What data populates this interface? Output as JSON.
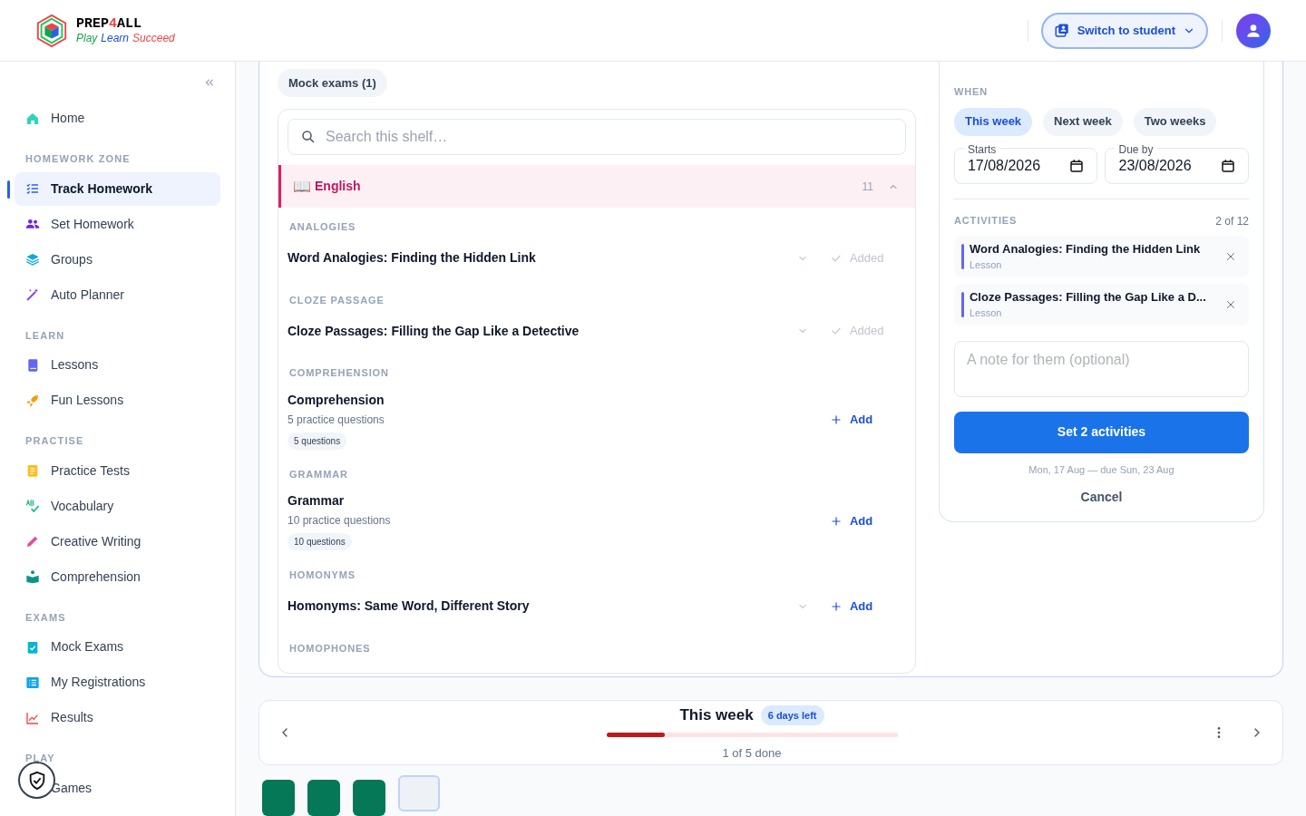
{
  "header": {
    "logo": {
      "name_parts": [
        "PREP",
        "4",
        "ALL"
      ],
      "tagline": [
        "Play",
        "Learn",
        "Succeed"
      ]
    },
    "switch_button": "Switch to student"
  },
  "sidebar": {
    "sections": [
      {
        "items": [
          {
            "label": "Home",
            "selected": false
          }
        ]
      },
      {
        "heading": "HOMEWORK ZONE",
        "items": [
          {
            "label": "Track Homework",
            "selected": true
          },
          {
            "label": "Set Homework",
            "selected": false
          },
          {
            "label": "Groups",
            "selected": false
          },
          {
            "label": "Auto Planner",
            "selected": false
          }
        ]
      },
      {
        "heading": "LEARN",
        "items": [
          {
            "label": "Lessons",
            "selected": false
          },
          {
            "label": "Fun Lessons",
            "selected": false
          }
        ]
      },
      {
        "heading": "PRACTISE",
        "items": [
          {
            "label": "Practice Tests",
            "selected": false
          },
          {
            "label": "Vocabulary",
            "selected": false
          },
          {
            "label": "Creative Writing",
            "selected": false
          },
          {
            "label": "Comprehension",
            "selected": false
          }
        ]
      },
      {
        "heading": "EXAMS",
        "items": [
          {
            "label": "Mock Exams",
            "selected": false
          },
          {
            "label": "My Registrations",
            "selected": false
          },
          {
            "label": "Results",
            "selected": false
          }
        ]
      },
      {
        "heading": "PLAY",
        "items": [
          {
            "label": "Games",
            "selected": false
          }
        ]
      }
    ]
  },
  "shelf": {
    "chip": "Mock exams (1)",
    "search": {
      "placeholder": "Search this shelf…"
    },
    "subject": {
      "emoji": "📖",
      "label": "English",
      "count": "11",
      "expanded": true
    },
    "groups": [
      {
        "heading": "ANALOGIES",
        "items": [
          {
            "title": "Word Analogies: Finding the Hidden Link",
            "expandable": true,
            "added": true,
            "action": "Added"
          }
        ]
      },
      {
        "heading": "CLOZE PASSAGE",
        "items": [
          {
            "title": "Cloze Passages: Filling the Gap Like a Detective",
            "expandable": true,
            "added": true,
            "action": "Added"
          }
        ]
      },
      {
        "heading": "COMPREHENSION",
        "items": [
          {
            "title": "Comprehension",
            "subtitle": "5 practice questions",
            "badge": "5 questions",
            "expandable": false,
            "added": false,
            "action": "Add"
          }
        ]
      },
      {
        "heading": "GRAMMAR",
        "items": [
          {
            "title": "Grammar",
            "subtitle": "10 practice questions",
            "badge": "10 questions",
            "expandable": false,
            "added": false,
            "action": "Add"
          }
        ]
      },
      {
        "heading": "HOMONYMS",
        "items": [
          {
            "title": "Homonyms: Same Word, Different Story",
            "expandable": true,
            "added": false,
            "action": "Add"
          }
        ]
      },
      {
        "heading": "HOMOPHONES"
      }
    ]
  },
  "set_homework": {
    "when_label": "WHEN",
    "periods": [
      {
        "label": "This week",
        "selected": true
      },
      {
        "label": "Next week",
        "selected": false
      },
      {
        "label": "Two weeks",
        "selected": false
      }
    ],
    "dates": [
      {
        "label": "Starts",
        "value": "17/08/2026"
      },
      {
        "label": "Due by",
        "value": "23/08/2026"
      }
    ],
    "activities_label": "ACTIVITIES",
    "activities_count": "2 of 12",
    "activities": [
      {
        "title": "Word Analogies: Finding the Hidden Link",
        "type": "Lesson"
      },
      {
        "title": "Cloze Passages: Filling the Gap Like a D...",
        "type": "Lesson"
      }
    ],
    "note": {
      "placeholder": "A note for them (optional)"
    },
    "submit": "Set 2 activities",
    "summary": "Mon, 17 Aug — due Sun, 23 Aug",
    "cancel": "Cancel"
  },
  "week": {
    "title": "This week",
    "badge": "6 days left",
    "level": 0.2,
    "progress_text": "1 of 5 done",
    "days": [
      {
        "done": true,
        "selected": false
      },
      {
        "done": true,
        "selected": false
      },
      {
        "done": true,
        "selected": false
      },
      {
        "done": false,
        "selected": true
      }
    ]
  }
}
